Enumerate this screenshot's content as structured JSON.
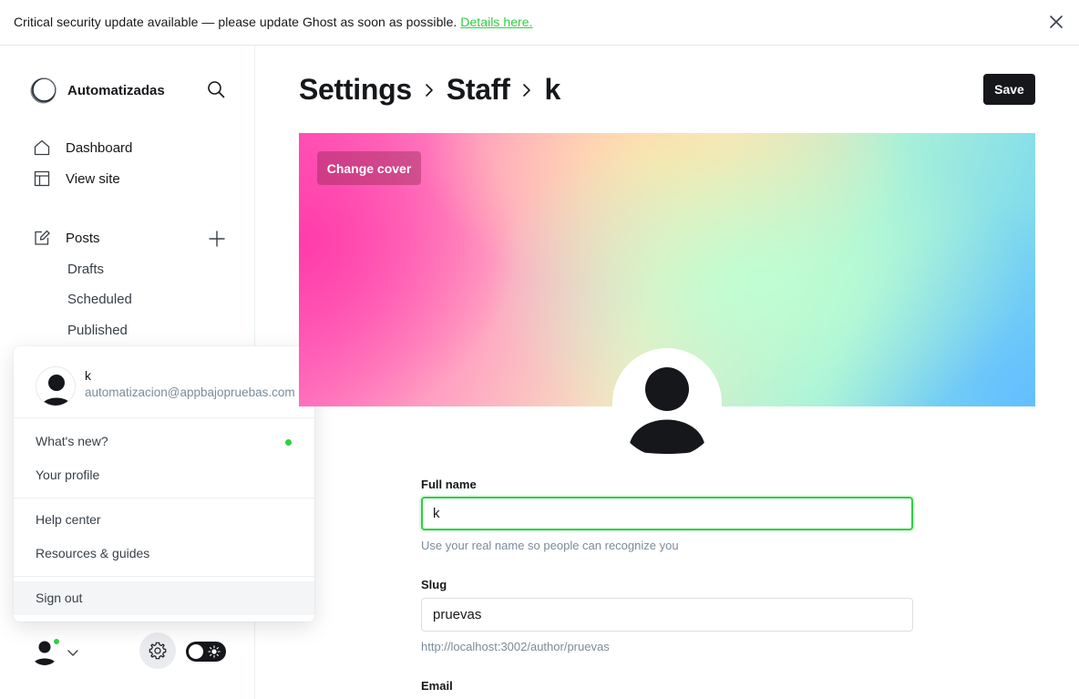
{
  "banner": {
    "text": "Critical security update available — please update Ghost as soon as possible.",
    "link": "Details here."
  },
  "sidebar": {
    "site_name": "Automatizadas",
    "nav": [
      {
        "label": "Dashboard",
        "icon": "home-icon"
      },
      {
        "label": "View site",
        "icon": "layout-icon"
      },
      {
        "label": "Posts",
        "icon": "edit-icon"
      }
    ],
    "posts_sub": [
      "Drafts",
      "Scheduled",
      "Published"
    ]
  },
  "user_menu": {
    "name": "k",
    "email": "automatizacion@appbajopruebas.com",
    "items": [
      "What's new?",
      "Your profile",
      "Help center",
      "Resources & guides",
      "Sign out"
    ]
  },
  "header": {
    "crumbs": [
      "Settings",
      "Staff",
      "k"
    ],
    "save_label": "Save"
  },
  "cover": {
    "change_label": "Change cover"
  },
  "form": {
    "full_name_label": "Full name",
    "full_name_value": "k",
    "full_name_hint": "Use your real name so people can recognize you",
    "slug_label": "Slug",
    "slug_value": "pruevas",
    "slug_hint": "http://localhost:3002/author/pruevas",
    "email_label": "Email"
  },
  "colors": {
    "accent": "#30cf43",
    "dark": "#15171a"
  }
}
